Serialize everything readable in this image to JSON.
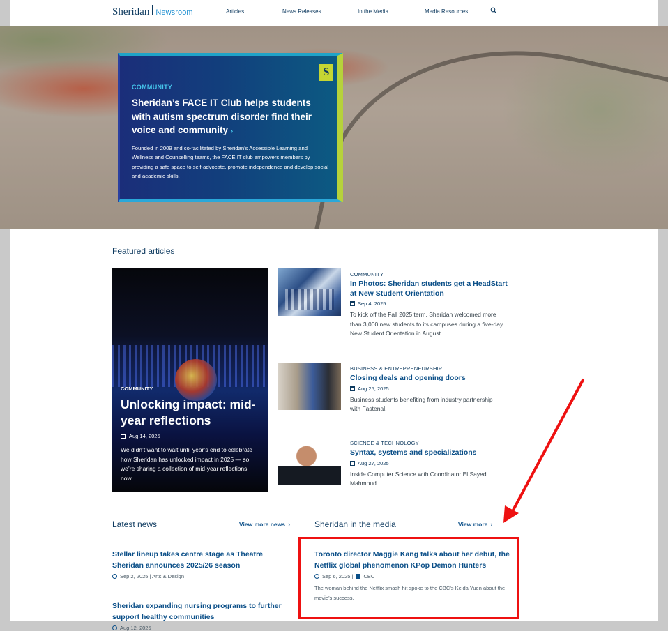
{
  "header": {
    "brand": "Sheridan",
    "section": "Newsroom",
    "nav": [
      {
        "label": "Articles"
      },
      {
        "label": "News Releases"
      },
      {
        "label": "In the Media"
      },
      {
        "label": "Media Resources"
      }
    ],
    "search_icon": "search-icon"
  },
  "hero": {
    "eyebrow": "COMMUNITY",
    "title": "Sheridan’s FACE IT Club helps students with autism spectrum disorder find their voice and community",
    "chevron": "›",
    "body": "Founded in 2009 and co-facilitated by Sheridan’s Accessible Learning and Wellness and Counselling teams, the FACE IT club empowers members by providing a safe space to self-advocate, promote independence and develop social and academic skills.",
    "badge": "S"
  },
  "featured": {
    "title": "Featured articles",
    "main": {
      "eyebrow": "COMMUNITY",
      "title": "Unlocking impact: mid-year reflections",
      "date": "Aug 14, 2025",
      "desc": "We didn’t want to wait until year’s end to celebrate how Sheridan has unlocked impact in 2025 — so we’re sharing a collection of mid-year reflections now."
    },
    "articles": [
      {
        "eyebrow": "COMMUNITY",
        "title": "In Photos: Sheridan students get a HeadStart at New Student Orientation",
        "date": "Sep 4, 2025",
        "desc": "To kick off the Fall 2025 term, Sheridan welcomed more than 3,000 new students to its campuses during a five-day New Student Orientation in August."
      },
      {
        "eyebrow": "BUSINESS & ENTREPRENEURSHIP",
        "title": "Closing deals and opening doors",
        "date": "Aug 25, 2025",
        "desc": "Business students benefiting from industry partnership with Fastenal."
      },
      {
        "eyebrow": "SCIENCE & TECHNOLOGY",
        "title": "Syntax, systems and specializations",
        "date": "Aug 27, 2025",
        "desc": "Inside Computer Science with Coordinator El Sayed Mahmoud."
      }
    ]
  },
  "latest": {
    "title": "Latest news",
    "view_more": "View more news",
    "items": [
      {
        "title": "Stellar lineup takes centre stage as Theatre Sheridan announces 2025/26 season",
        "meta": "Sep 2, 2025 | Arts & Design"
      },
      {
        "title": "Sheridan expanding nursing programs to further support healthy communities",
        "meta": "Aug 12, 2025"
      }
    ]
  },
  "media": {
    "title": "Sheridan in the media",
    "view_more": "View more",
    "item": {
      "title": "Toronto director Maggie Kang talks about her debut, the Netflix global phenomenon KPop Demon Hunters",
      "meta": "Sep 6, 2025 |",
      "source": "CBC",
      "desc": "The woman behind the Netflix smash hit spoke to the CBC’s Kelda Yuen about the movie’s success."
    }
  },
  "chevron": "›",
  "colors": {
    "accent": "#0b4f88",
    "highlight": "#ee1111",
    "card_lime": "#b6d23b",
    "card_cyan": "#46c6ec"
  }
}
